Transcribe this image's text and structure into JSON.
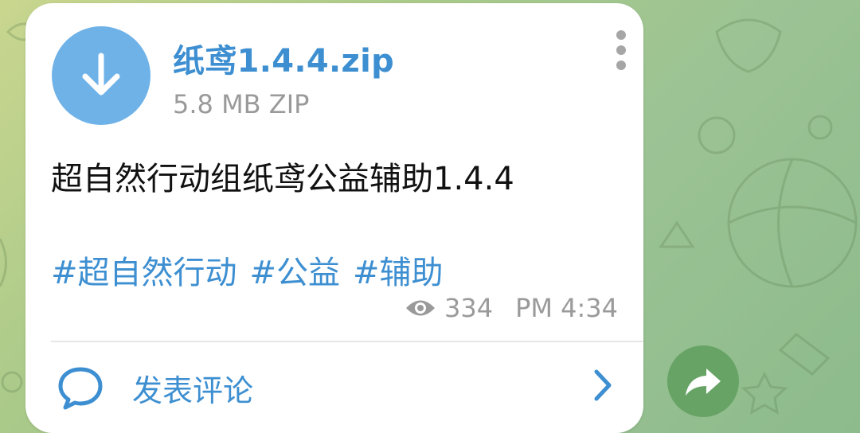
{
  "message": {
    "file": {
      "name": "纸鸢1.4.4.zip",
      "meta": "5.8 MB ZIP",
      "icon": "download-icon"
    },
    "caption": "超自然行动组纸鸢公益辅助1.4.4",
    "hashtags": [
      "#超自然行动",
      "#公益",
      "#辅助"
    ],
    "views": "334",
    "time": "PM 4:34",
    "comment_label": "发表评论"
  },
  "colors": {
    "accent": "#3d8fd1",
    "file_icon_bg": "#6fb2e8",
    "share_bg": "#68a366",
    "muted": "#9a9a9a"
  }
}
